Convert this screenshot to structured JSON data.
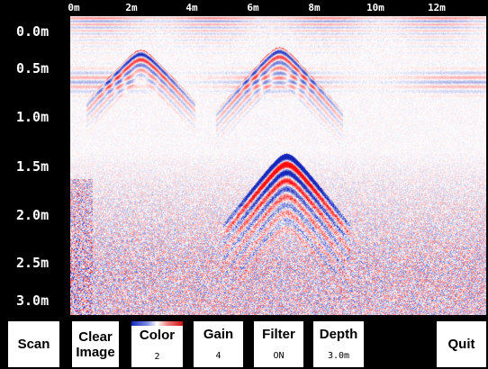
{
  "axis": {
    "x_ticks": [
      "0m",
      "2m",
      "4m",
      "6m",
      "8m",
      "10m",
      "12m"
    ],
    "y_ticks": [
      "0.0m",
      "0.5m",
      "1.0m",
      "1.5m",
      "2.0m",
      "2.5m",
      "3.0m"
    ]
  },
  "scan": {
    "colors": {
      "positive": "#d01010",
      "negative": "#1028c0",
      "neutral": "#ffffff"
    }
  },
  "toolbar": {
    "scan_label": "Scan",
    "clear_line1": "Clear",
    "clear_line2": "Image",
    "color_label": "Color",
    "color_value": "2",
    "gain_label": "Gain",
    "gain_value": "4",
    "filter_label": "Filter",
    "filter_value": "ON",
    "depth_label": "Depth",
    "depth_value": "3.0m",
    "quit_label": "Quit"
  }
}
